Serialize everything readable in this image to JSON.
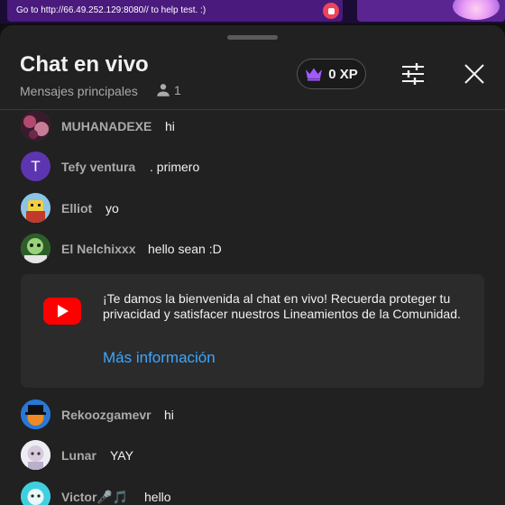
{
  "video": {
    "overlay_text": "Go to http://66.49.252.129:8080// to help test. :)"
  },
  "chat": {
    "title": "Chat en vivo",
    "mode": "Mensajes principales",
    "viewer_count": "1",
    "xp_label": "0 XP"
  },
  "messages_top": [
    {
      "author": "MUHANADEXE",
      "text": "hi",
      "avatar_color": "#8a3a5a"
    },
    {
      "author": "Tefy ventura",
      "text": ". primero",
      "avatar_color": "#5e35b1",
      "avatar_letter": "T"
    },
    {
      "author": "Elliot",
      "text": "yo",
      "avatar_color": "#7fb6d8"
    },
    {
      "author": "El Nelchixxx",
      "text": "hello sean :D",
      "avatar_color": "#6aa84f"
    }
  ],
  "welcome": {
    "text": "¡Te damos la bienvenida al chat en vivo! Recuerda proteger tu privacidad y satisfacer nuestros Lineamientos de la Comunidad.",
    "link": "Más información"
  },
  "messages_bottom": [
    {
      "author": "Rekoozgamevr",
      "text": "hi",
      "avatar_color": "#1f5fbf"
    },
    {
      "author": "Lunar",
      "text": "YAY",
      "avatar_color": "#e9e9f2"
    },
    {
      "author": "Victor🎤🎵",
      "text": "hello",
      "avatar_color": "#38c9d8"
    }
  ],
  "colors": {
    "accent_link": "#3ea6ff",
    "crown": "#a259ff",
    "youtube_red": "#ff0000"
  },
  "icons": {
    "viewers": "person-icon",
    "xp": "crown-icon",
    "filter": "sliders-icon",
    "close": "close-icon"
  }
}
